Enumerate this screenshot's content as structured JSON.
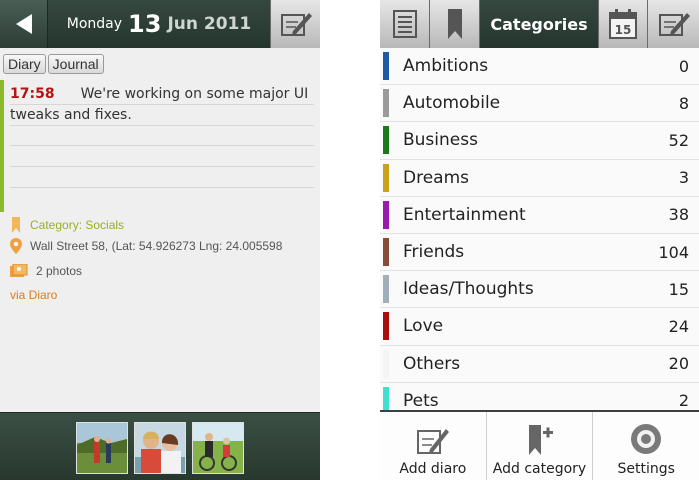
{
  "left": {
    "header": {
      "day_of_week": "Monday",
      "day": "13",
      "month_year": "Jun 2011"
    },
    "tags": [
      "Diary",
      "Journal"
    ],
    "entry": {
      "time": "17:58",
      "text": "We're working on some major UI tweaks and fixes."
    },
    "meta": {
      "category": "Category: Socials",
      "location": "Wall Street 58, (Lat: 54.926273 Lng: 24.005598",
      "photos": "2 photos",
      "via": "via Diaro"
    },
    "colors": {
      "accent_bar": "#8cb92a",
      "time": "#b31414",
      "category": "#9aaf22",
      "via": "#e07b1f"
    }
  },
  "right": {
    "header": {
      "title": "Categories",
      "calendar_day": "15"
    },
    "categories": [
      {
        "name": "Ambitions",
        "count": "0",
        "color": "#1f5aa6"
      },
      {
        "name": "Automobile",
        "count": "8",
        "color": "#9a9a9a"
      },
      {
        "name": "Business",
        "count": "52",
        "color": "#1a7a1a"
      },
      {
        "name": "Dreams",
        "count": "3",
        "color": "#c9a21a"
      },
      {
        "name": "Entertainment",
        "count": "38",
        "color": "#9a1ab0"
      },
      {
        "name": "Friends",
        "count": "104",
        "color": "#8a4a38"
      },
      {
        "name": "Ideas/Thoughts",
        "count": "15",
        "color": "#9fb0b8"
      },
      {
        "name": "Love",
        "count": "24",
        "color": "#a80e0e"
      },
      {
        "name": "Others",
        "count": "20",
        "color": "#f4f4f4"
      },
      {
        "name": "Pets",
        "count": "2",
        "color": "#3fe0d0"
      }
    ],
    "menu": {
      "add_diaro": "Add diaro",
      "add_category": "Add category",
      "settings": "Settings"
    }
  }
}
